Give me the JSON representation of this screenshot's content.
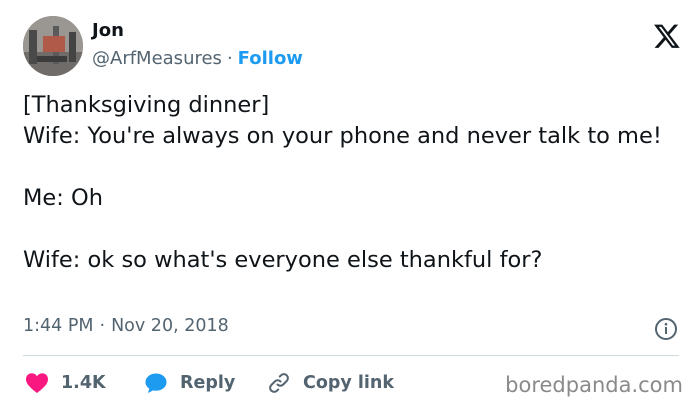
{
  "author": {
    "name": "Jon",
    "handle": "@ArfMeasures",
    "separator": "·",
    "follow_label": "Follow"
  },
  "tweet": {
    "text": "[Thanksgiving dinner]\nWife: You're always on your phone and never talk to me!\n\nMe: Oh\n\nWife: ok so what's everyone else thankful for?",
    "time": "1:44 PM",
    "separator": "·",
    "date": "Nov 20, 2018"
  },
  "actions": {
    "like_count": "1.4K",
    "reply_label": "Reply",
    "copy_link_label": "Copy link"
  },
  "icons": {
    "logo": "x-logo-icon",
    "info": "info-icon",
    "like": "heart-icon",
    "reply": "speech-bubble-icon",
    "copy_link": "link-icon"
  },
  "colors": {
    "like": "#f91880",
    "reply": "#1d9bf0",
    "follow": "#1d9bf0",
    "text": "#0f1419",
    "muted": "#536471"
  },
  "watermark": "boredpanda.com"
}
